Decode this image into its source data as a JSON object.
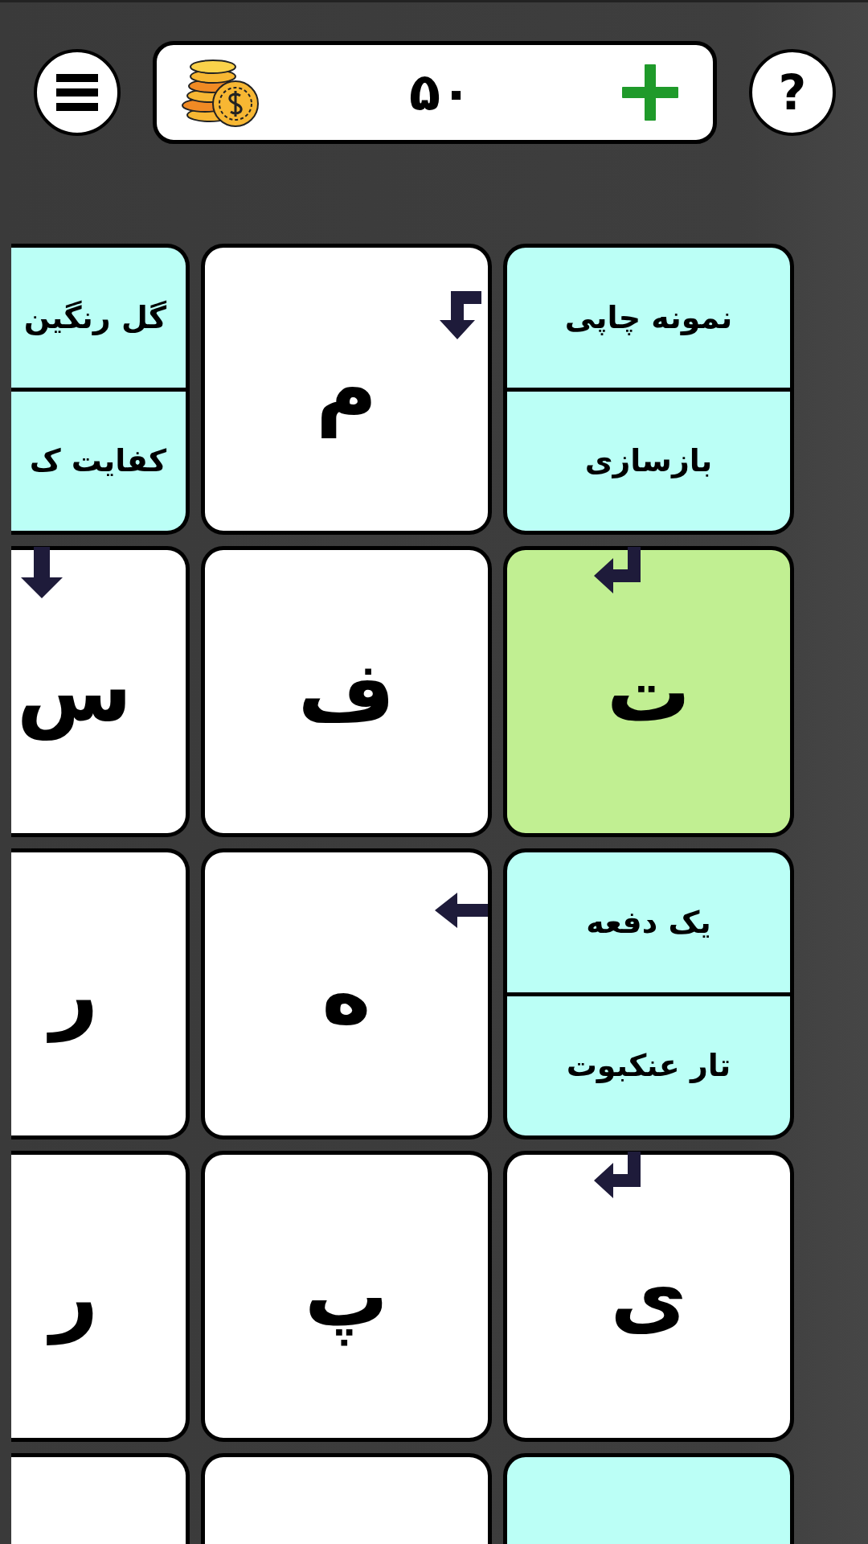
{
  "header": {
    "coins": {
      "amount": "۵۰"
    },
    "help": {
      "label": "?"
    }
  },
  "grid": [
    [
      {
        "kind": "clue",
        "clues": [
          "نمونه چاپی",
          "بازسازی"
        ]
      },
      {
        "kind": "letter",
        "letter": "م",
        "selected": false,
        "arrow": {
          "kind": "bent-down"
        }
      },
      {
        "kind": "clue",
        "clues": [
          "گل رنگین",
          "کفایت ک"
        ]
      }
    ],
    [
      {
        "kind": "letter",
        "letter": "ت",
        "selected": true,
        "arrow": {
          "kind": "return"
        }
      },
      {
        "kind": "letter",
        "letter": "ف",
        "selected": false
      },
      {
        "kind": "letter",
        "letter": "س",
        "selected": false,
        "arrow": {
          "kind": "down"
        }
      }
    ],
    [
      {
        "kind": "clue",
        "clues": [
          "یک دفعه",
          "تار عنکبوت"
        ]
      },
      {
        "kind": "letter",
        "letter": "ه",
        "selected": false,
        "arrow": {
          "kind": "left"
        }
      },
      {
        "kind": "letter",
        "letter": "ر",
        "selected": false
      }
    ],
    [
      {
        "kind": "letter",
        "letter": "ی",
        "selected": false,
        "arrow": {
          "kind": "return"
        }
      },
      {
        "kind": "letter",
        "letter": "پ",
        "selected": false
      },
      {
        "kind": "letter",
        "letter": "ر",
        "selected": false
      }
    ],
    [
      {
        "kind": "clue"
      },
      {
        "kind": "letter",
        "selected": false
      },
      {
        "kind": "letter",
        "selected": false
      }
    ]
  ]
}
